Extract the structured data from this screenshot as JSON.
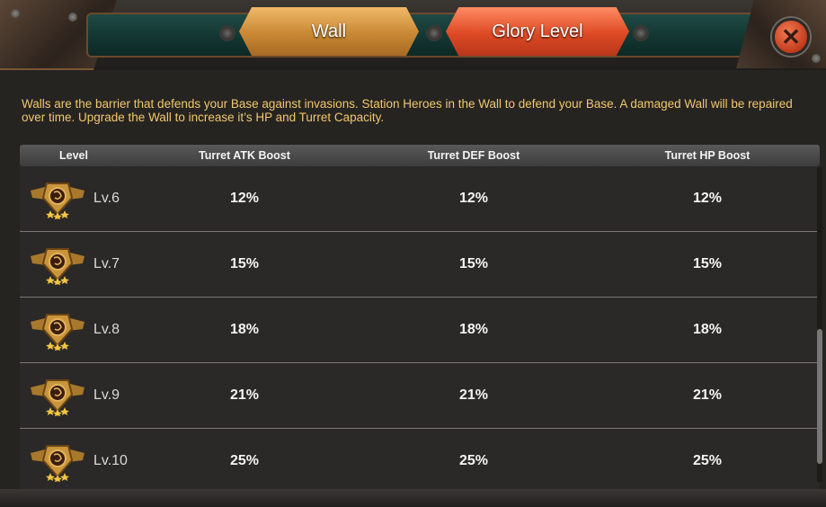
{
  "tabs": [
    {
      "label": "Wall",
      "active": false
    },
    {
      "label": "Glory Level",
      "active": true
    }
  ],
  "description": "Walls are the barrier that defends your Base against invasions. Station Heroes in the Wall to defend your Base. A damaged Wall will be repaired over time. Upgrade the Wall to increase it’s HP and Turret Capacity.",
  "table": {
    "headers": [
      "Level",
      "Turret ATK Boost",
      "Turret DEF Boost",
      "Turret HP Boost"
    ],
    "rows": [
      {
        "level": "Lv.6",
        "atk": "12%",
        "def": "12%",
        "hp": "12%"
      },
      {
        "level": "Lv.7",
        "atk": "15%",
        "def": "15%",
        "hp": "15%"
      },
      {
        "level": "Lv.8",
        "atk": "18%",
        "def": "18%",
        "hp": "18%"
      },
      {
        "level": "Lv.9",
        "atk": "21%",
        "def": "21%",
        "hp": "21%"
      },
      {
        "level": "Lv.10",
        "atk": "25%",
        "def": "25%",
        "hp": "25%"
      }
    ]
  },
  "colors": {
    "description_text": "#f0c76f",
    "tab_wall": "#c88835",
    "tab_glory": "#dd4a24",
    "close": "#c23b1b"
  },
  "icons": {
    "close": "close-icon",
    "level_badge": "level-badge-icon"
  }
}
